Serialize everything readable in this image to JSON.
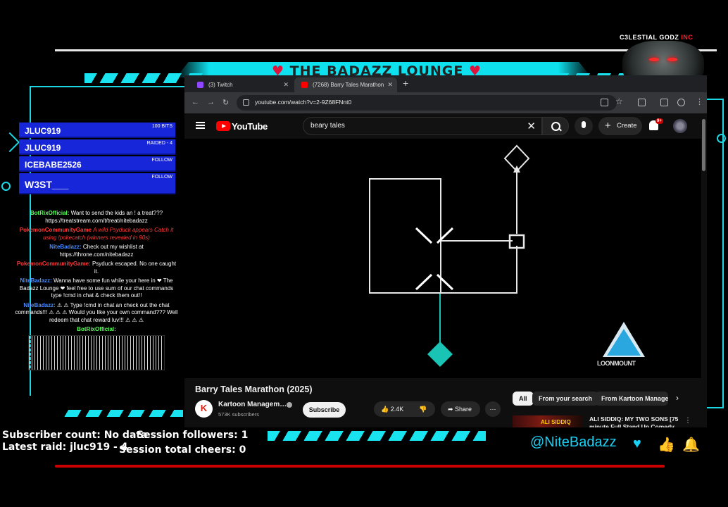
{
  "overlay": {
    "title": "THE BADAZZ LOUNGE",
    "brand": {
      "main": "C3LESTIAL GODZ",
      "suffix": "INC"
    },
    "handle": "@NiteBadazz"
  },
  "alerts": [
    {
      "name": "JLUC919",
      "tag": "100 BITS"
    },
    {
      "name": "JLUC919",
      "tag": "RAIDED - 4"
    },
    {
      "name": "ICEBABE2526",
      "tag": "FOLLOW"
    },
    {
      "name": "W3ST___",
      "tag": "FOLLOW"
    }
  ],
  "chat": [
    {
      "user": "BotRixOfficial:",
      "text": "Want to send the kids an ! a treat??? https://treatstream.com/t/treat/nitebadazz"
    },
    {
      "user": "PokemonCommunityGame",
      "text": "A wild Psyduck appears Catch it using !pokecatch (winners revealed in 90s)"
    },
    {
      "user": "NiteBadazz:",
      "text": "Check out my wishlist at https://throne.com/nitebadazz"
    },
    {
      "user": "PokemonCommunityGame:",
      "text": "Psyduck escaped. No one caught it."
    },
    {
      "user": "NiteBadazz:",
      "text": "Wanna have some fun while your here in ❤ The Badazz Lounge ❤ feel free to use sum of our chat commands type !cmd in chat & check them out!!"
    },
    {
      "user": "NiteBadazz:",
      "text": "⚠ ⚠ Type !cmd in chat an check out the chat commands!!! ⚠ ⚠ ⚠ Would you like your own command??? Well redeem that chat reward luv!!! ⚠ ⚠ ⚠"
    },
    {
      "user": "BotRixOfficial:",
      "text": ""
    }
  ],
  "browser": {
    "tabs": [
      {
        "label": "(3) Twitch",
        "color": "#9146ff"
      },
      {
        "label": "(7268) Barry Tales Marathon",
        "color": "#ff0000"
      }
    ],
    "url": "youtube.com/watch?v=2-9Z68FNnt0"
  },
  "youtube": {
    "search_query": "beary tales",
    "logo_text": "YouTube",
    "create_label": "Create",
    "notification_badge": "9+",
    "video_title": "Barry Tales Marathon (2025)",
    "channel_name": "Kartoon Managem…",
    "subscribers": "573K subscribers",
    "subscribe_label": "Subscribe",
    "likes": "2.4K",
    "share_label": "Share",
    "chips": [
      "All",
      "From your search",
      "From Kartoon Manager"
    ],
    "watermark": "LOONMOUNT",
    "recommended": {
      "thumb_text": "ALI SIDDIQ",
      "title": "ALI SIDDIQ: MY TWO SONS [75 minute Full Stand Up Comedy"
    }
  },
  "stats": {
    "subscriber_count": "Subscriber count: No data",
    "session_followers": "Session followers: 1",
    "latest_raid": "Latest raid: jluc919 - 4",
    "session_cheers": "Session total cheers: 0"
  }
}
